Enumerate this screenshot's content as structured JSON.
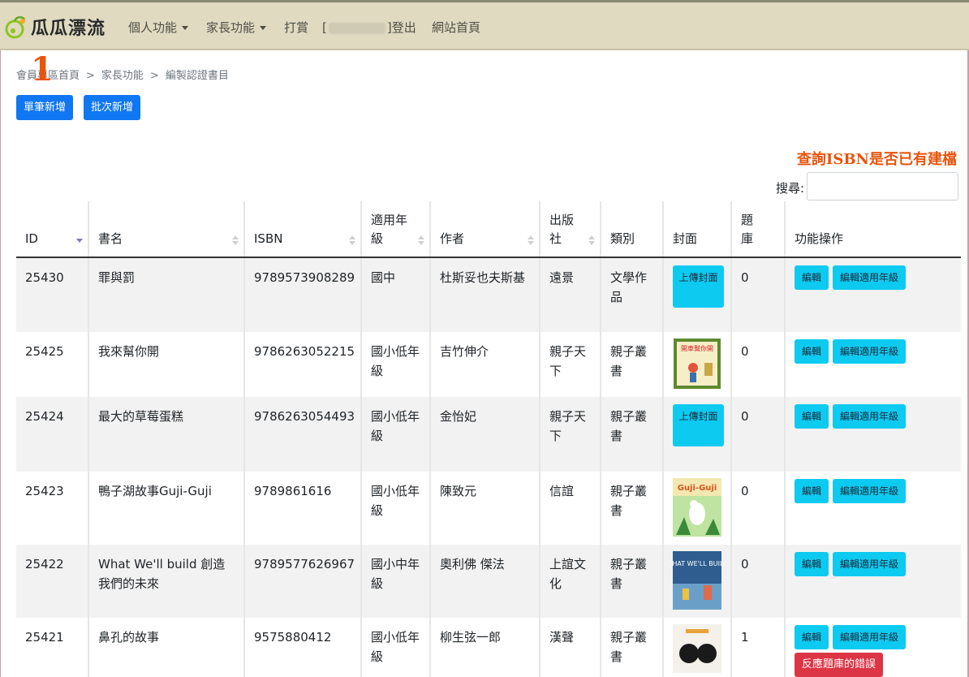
{
  "nav": {
    "brand": "瓜瓜漂流",
    "personal": "個人功能",
    "parent": "家長功能",
    "tip": "打賞",
    "login_prefix": "[",
    "login_suffix": "]登出",
    "home": "網站首頁"
  },
  "breadcrumb": {
    "item1": "會員專區首頁",
    "item2": "家長功能",
    "item3": "編製認證書目",
    "sep": ">"
  },
  "annotation_number": "1",
  "buttons": {
    "single_add": "單筆新增",
    "batch_add": "批次新增"
  },
  "isbn_note": "查詢ISBN是否已有建檔",
  "search": {
    "label": "搜尋:",
    "value": ""
  },
  "table": {
    "headers": [
      "ID",
      "書名",
      "ISBN",
      "適用年級",
      "作者",
      "出版社",
      "類別",
      "封面",
      "題庫",
      "功能操作"
    ],
    "edit_label": "編輯",
    "edit_grade_label": "編輯適用年級",
    "upload_label": "上傳封面",
    "report_label": "反應題庫的錯誤",
    "rows": [
      {
        "id": "25430",
        "title": "罪與罰",
        "isbn": "9789573908289",
        "grade": "國中",
        "author": "杜斯妥也夫斯基",
        "publisher": "遠景",
        "category": "文學作品",
        "cover": "upload",
        "quiz": "0"
      },
      {
        "id": "25425",
        "title": "我來幫你開",
        "isbn": "9786263052215",
        "grade": "國小低年級",
        "author": "吉竹伸介",
        "publisher": "親子天下",
        "category": "親子叢書",
        "cover": "image",
        "quiz": "0"
      },
      {
        "id": "25424",
        "title": "最大的草莓蛋糕",
        "isbn": "9786263054493",
        "grade": "國小低年級",
        "author": "金怡妃",
        "publisher": "親子天下",
        "category": "親子叢書",
        "cover": "upload",
        "quiz": "0"
      },
      {
        "id": "25423",
        "title": "鴨子湖故事Guji-Guji",
        "isbn": "9789861616",
        "grade": "國小低年級",
        "author": "陳致元",
        "publisher": "信誼",
        "category": "親子叢書",
        "cover": "image",
        "quiz": "0"
      },
      {
        "id": "25422",
        "title": "What We'll build 創造我們的未來",
        "isbn": "9789577626967",
        "grade": "國小中年級",
        "author": "奧利佛 傑法",
        "publisher": "上誼文化",
        "category": "親子叢書",
        "cover": "image",
        "quiz": "0"
      },
      {
        "id": "25421",
        "title": "鼻孔的故事",
        "isbn": "9575880412",
        "grade": "國小低年級",
        "author": "柳生弦一郎",
        "publisher": "漢聲",
        "category": "親子叢書",
        "cover": "image",
        "quiz": "1"
      }
    ]
  },
  "cover_texts": {
    "c1": "開車幫你開",
    "c2": "Guji-Guji",
    "c3": "WHAT WE'LL BUILD"
  },
  "colors": {
    "navbar": "#dfdac0",
    "primary": "#1077f3",
    "info": "#0dcaf0",
    "danger": "#dc3545",
    "annotation": "#e8540e"
  }
}
